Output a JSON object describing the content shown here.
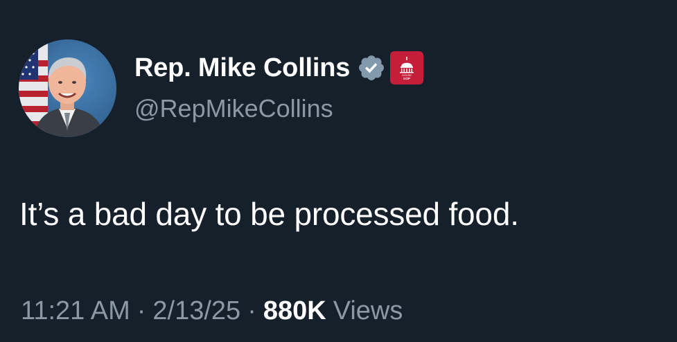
{
  "author": {
    "display_name": "Rep. Mike Collins",
    "handle": "@RepMikeCollins",
    "verified_icon": "verified-badge-icon",
    "affiliation_badge": {
      "icon": "capitol-dome-icon",
      "text_line1": "HOUSE",
      "text_line2": "GOP",
      "color": "#c41e3a"
    },
    "avatar_icon": "profile-photo"
  },
  "tweet": {
    "text": "It’s a bad day to be processed food."
  },
  "meta": {
    "time": "11:21 AM",
    "date": "2/13/25",
    "separator": "·",
    "views_count": "880K",
    "views_label": "Views"
  },
  "colors": {
    "background": "#15202b",
    "primary_text": "#ffffff",
    "secondary_text": "#8b98a5",
    "verified_badge": "#829aab"
  }
}
